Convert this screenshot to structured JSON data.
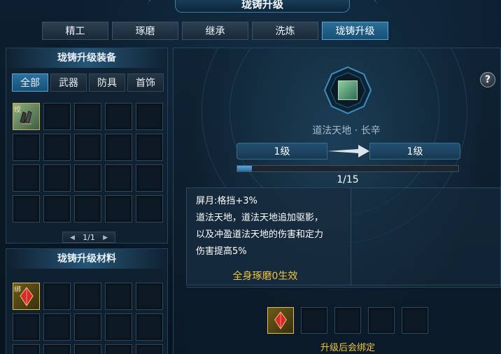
{
  "window": {
    "title": "珑铸升级"
  },
  "tabs": [
    {
      "label": "精工"
    },
    {
      "label": "琢磨"
    },
    {
      "label": "继承"
    },
    {
      "label": "洗炼"
    },
    {
      "label": "珑铸升级"
    }
  ],
  "equipment_panel": {
    "title": "珑铸升级装备",
    "filters": [
      {
        "label": "全部"
      },
      {
        "label": "武器"
      },
      {
        "label": "防具"
      },
      {
        "label": "首饰"
      }
    ],
    "pager": "1/1",
    "first_item_tag": "绞"
  },
  "materials_panel": {
    "title": "珑铸升级材料",
    "first_item_tag": "绑"
  },
  "upgrade": {
    "item_name": "道法天地 · 长辛",
    "level_from": "1级",
    "level_to": "1级",
    "progress_text": "1/15",
    "progress_fraction": 0.0667,
    "description": [
      "屏月:格挡+3%",
      "道法天地，道法天地追加驱影，",
      "以及冲盈道法天地的伤害和定力",
      "伤害提高5%"
    ],
    "polish_effect": "全身琢磨0生效",
    "bind_note": "升级后会绑定"
  },
  "icons": {
    "help": "?",
    "pager_prev": "◀",
    "pager_next": "▶"
  },
  "colors": {
    "accent_blue": "#2a72a0",
    "gold_text": "#f0c540"
  }
}
